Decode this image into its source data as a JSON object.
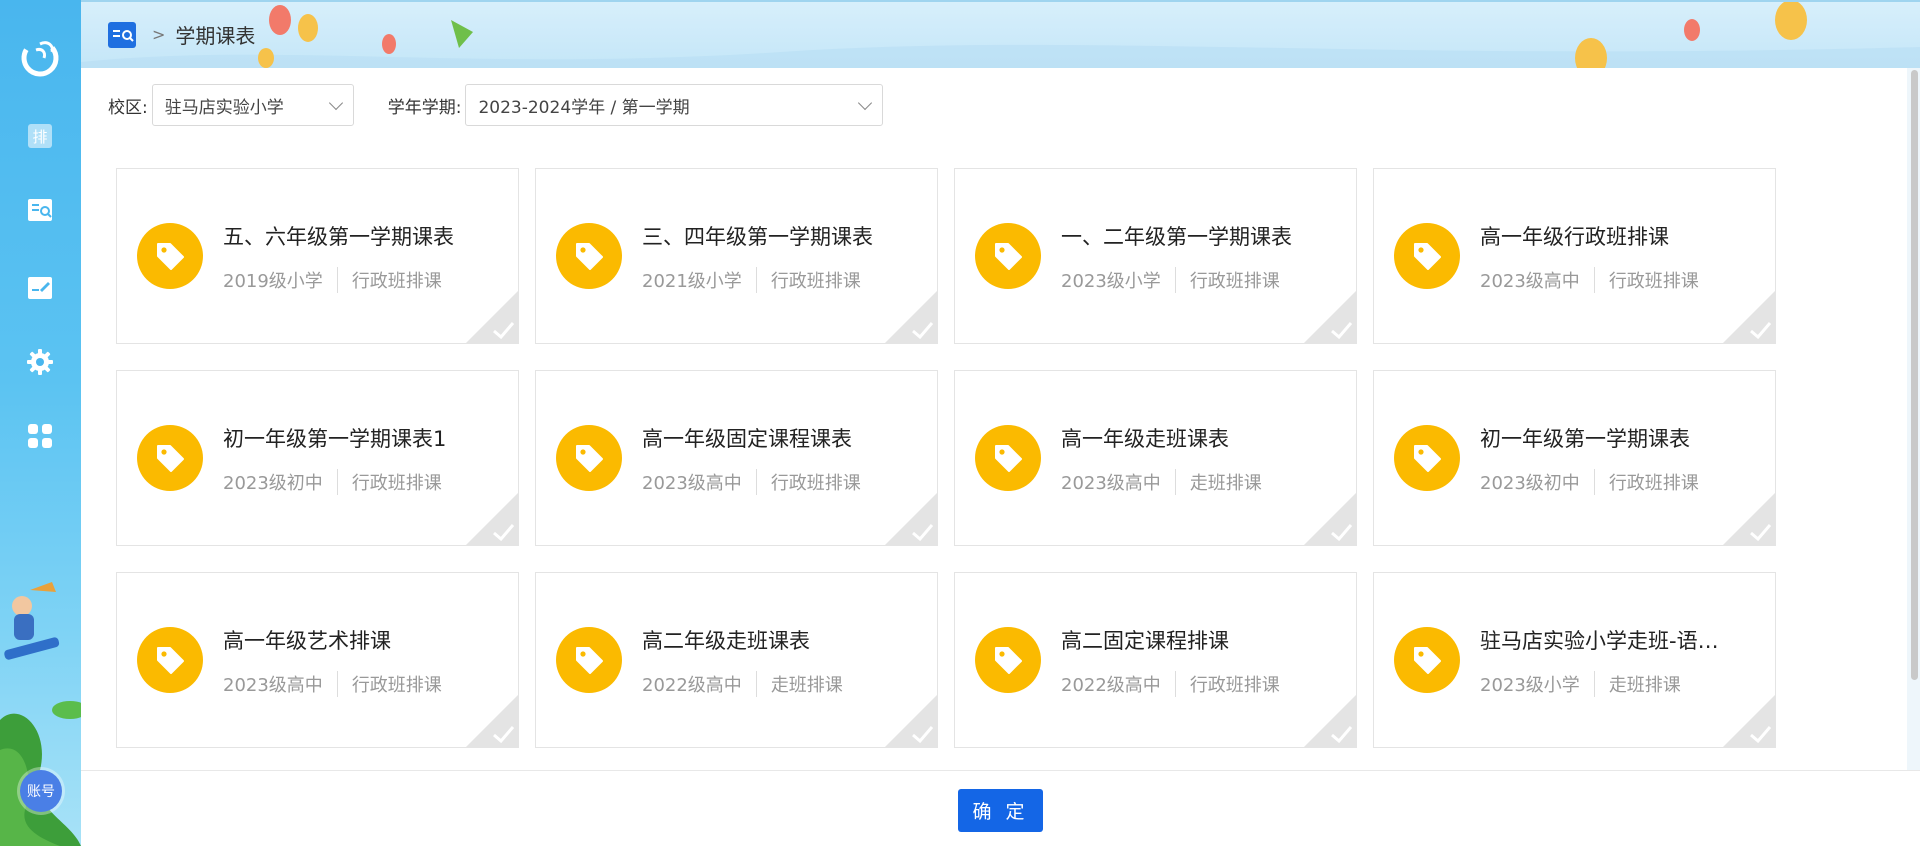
{
  "breadcrumb": {
    "title": "学期课表"
  },
  "filters": {
    "campus_label": "校区:",
    "campus_value": "驻马店实验小学",
    "term_label": "学年学期:",
    "term_value": "2023-2024学年 / 第一学期"
  },
  "cards": [
    {
      "title": "五、六年级第一学期课表",
      "grade": "2019级小学",
      "type": "行政班排课"
    },
    {
      "title": "三、四年级第一学期课表",
      "grade": "2021级小学",
      "type": "行政班排课"
    },
    {
      "title": "一、二年级第一学期课表",
      "grade": "2023级小学",
      "type": "行政班排课"
    },
    {
      "title": "高一年级行政班排课",
      "grade": "2023级高中",
      "type": "行政班排课"
    },
    {
      "title": "初一年级第一学期课表1",
      "grade": "2023级初中",
      "type": "行政班排课"
    },
    {
      "title": "高一年级固定课程课表",
      "grade": "2023级高中",
      "type": "行政班排课"
    },
    {
      "title": "高一年级走班课表",
      "grade": "2023级高中",
      "type": "走班排课"
    },
    {
      "title": "初一年级第一学期课表",
      "grade": "2023级初中",
      "type": "行政班排课"
    },
    {
      "title": "高一年级艺术排课",
      "grade": "2023级高中",
      "type": "行政班排课"
    },
    {
      "title": "高二年级走班课表",
      "grade": "2022级高中",
      "type": "走班排课"
    },
    {
      "title": "高二固定课程排课",
      "grade": "2022级高中",
      "type": "行政班排课"
    },
    {
      "title": "驻马店实验小学走班-语…",
      "grade": "2023级小学",
      "type": "走班排课"
    }
  ],
  "sidebar": {
    "items": [
      {
        "icon": "schedule-icon",
        "label": "排"
      },
      {
        "icon": "book-search-icon"
      },
      {
        "icon": "edit-board-icon"
      },
      {
        "icon": "gear-icon"
      },
      {
        "icon": "apps-grid-icon"
      }
    ],
    "account_label": "账号"
  },
  "footer": {
    "confirm_label": "确 定"
  },
  "colors": {
    "accent": "#1466e6",
    "tag": "#fbba00",
    "sidebar": "#49b6ee"
  }
}
